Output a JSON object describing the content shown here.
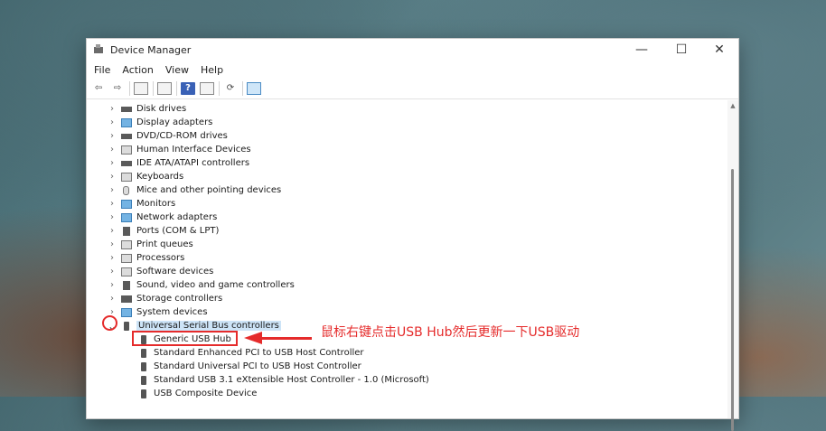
{
  "window": {
    "title": "Device Manager",
    "controls": {
      "minimize": "—",
      "maximize": "☐",
      "close": "✕"
    }
  },
  "menu": [
    "File",
    "Action",
    "View",
    "Help"
  ],
  "toolbar": {
    "icons": [
      "back-icon",
      "forward-icon",
      "show-hide-console-tree-icon",
      "properties-icon",
      "help-icon",
      "view-icon",
      "update-driver-icon",
      "scan-hardware-icon"
    ],
    "help_glyph": "?"
  },
  "tree": {
    "categories": [
      {
        "label": "Disk drives",
        "icon": "disk-drive-icon",
        "expanded": false
      },
      {
        "label": "Display adapters",
        "icon": "display-adapter-icon",
        "expanded": false
      },
      {
        "label": "DVD/CD-ROM drives",
        "icon": "dvd-drive-icon",
        "expanded": false
      },
      {
        "label": "Human Interface Devices",
        "icon": "hid-icon",
        "expanded": false
      },
      {
        "label": "IDE ATA/ATAPI controllers",
        "icon": "ide-controller-icon",
        "expanded": false
      },
      {
        "label": "Keyboards",
        "icon": "keyboard-icon",
        "expanded": false
      },
      {
        "label": "Mice and other pointing devices",
        "icon": "mouse-icon",
        "expanded": false
      },
      {
        "label": "Monitors",
        "icon": "monitor-icon",
        "expanded": false
      },
      {
        "label": "Network adapters",
        "icon": "network-adapter-icon",
        "expanded": false
      },
      {
        "label": "Ports (COM & LPT)",
        "icon": "port-icon",
        "expanded": false
      },
      {
        "label": "Print queues",
        "icon": "printer-icon",
        "expanded": false
      },
      {
        "label": "Processors",
        "icon": "processor-icon",
        "expanded": false
      },
      {
        "label": "Software devices",
        "icon": "software-device-icon",
        "expanded": false
      },
      {
        "label": "Sound, video and game controllers",
        "icon": "sound-icon",
        "expanded": false
      },
      {
        "label": "Storage controllers",
        "icon": "storage-controller-icon",
        "expanded": false
      },
      {
        "label": "System devices",
        "icon": "system-device-icon",
        "expanded": false
      },
      {
        "label": "Universal Serial Bus controllers",
        "icon": "usb-icon",
        "expanded": true
      }
    ],
    "usb_children": [
      "Generic USB Hub",
      "Standard Enhanced PCI to USB Host Controller",
      "Standard Universal PCI to USB Host Controller",
      "Standard USB 3.1 eXtensible Host Controller - 1.0 (Microsoft)",
      "USB Composite Device"
    ],
    "chevron_collapsed": "›",
    "chevron_expanded": "⌄"
  },
  "annotation": {
    "text": "鼠标右键点击USB Hub然后更新一下USB驱动",
    "color": "#e52b2b"
  },
  "colors": {
    "selected_row": "#cde4f7",
    "accent": "#e52b2b"
  }
}
